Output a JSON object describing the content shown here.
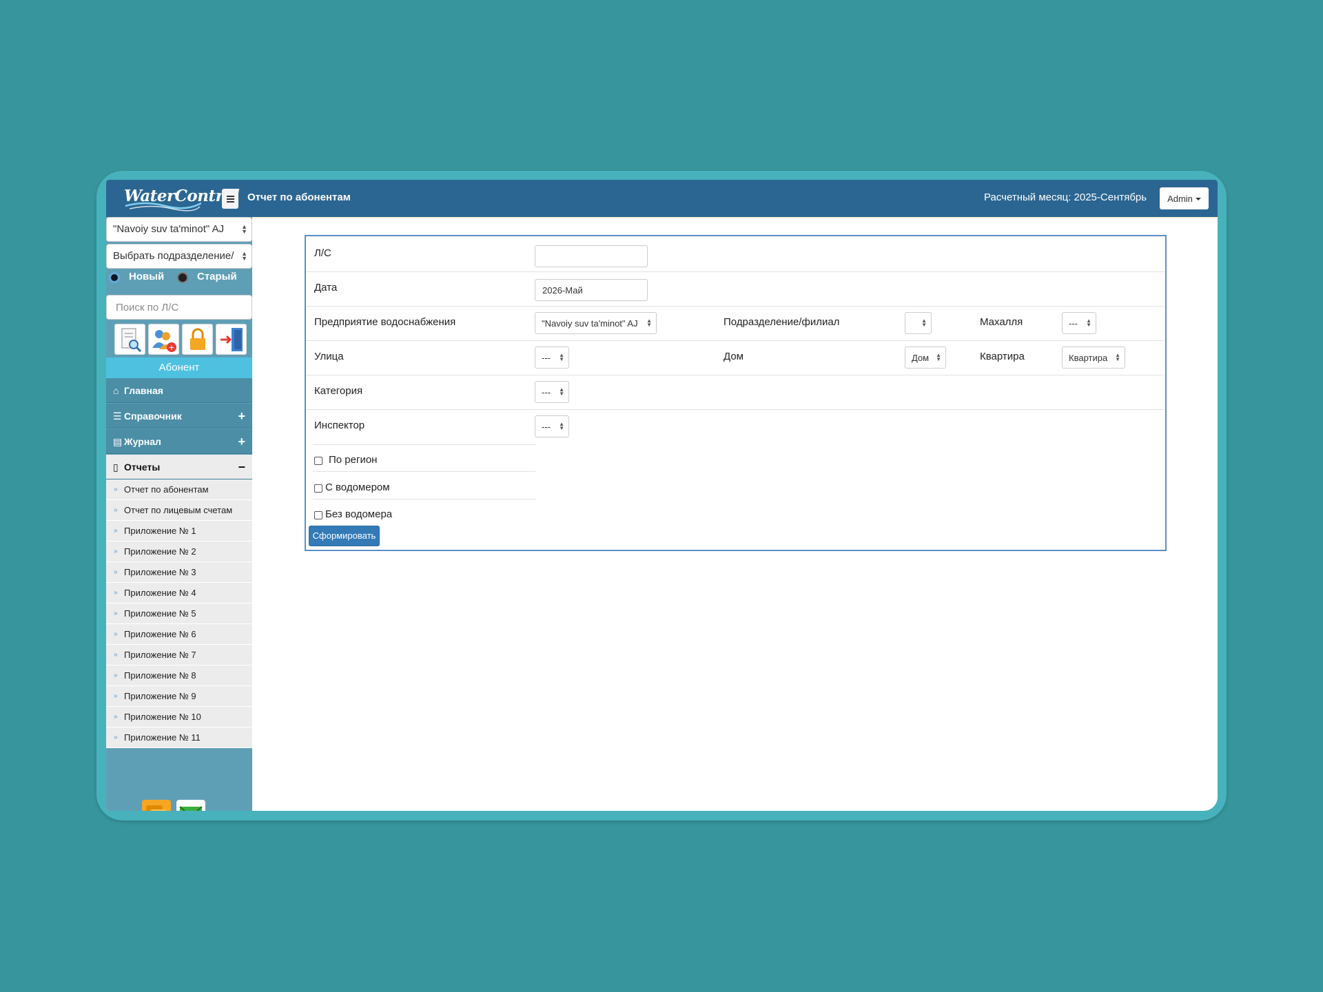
{
  "header": {
    "logo_text": "WaterControl",
    "page_title": "Отчет по абонентам",
    "billing_month": "Расчетный месяц: 2025-Сентябрь",
    "user_button": "Admin"
  },
  "sidebar": {
    "enterprise_select": "\"Navoiy suv ta'minot\" AJ",
    "division_select": "Выбрать подразделение/",
    "radio_new": "Новый",
    "radio_old": "Старый",
    "search_placeholder": "Поиск по Л/С",
    "tool_icons": [
      "search-document-icon",
      "add-user-icon",
      "lock-icon",
      "exit-door-icon"
    ],
    "abonent_label": "Абонент",
    "nav": {
      "home": "Главная",
      "directory": "Справочник",
      "journal": "Журнал",
      "reports": "Отчеты"
    },
    "report_items": [
      "Отчет по абонентам",
      "Отчет по лицевым счетам",
      "Приложение № 1",
      "Приложение № 2",
      "Приложение № 3",
      "Приложение № 4",
      "Приложение № 5",
      "Приложение № 6",
      "Приложение № 7",
      "Приложение № 8",
      "Приложение № 9",
      "Приложение № 10",
      "Приложение № 11"
    ],
    "bottom_icons": [
      "chat-icon",
      "mail-icon"
    ]
  },
  "form": {
    "ls_label": "Л/С",
    "ls_value": "",
    "date_label": "Дата",
    "date_value": "2026-Май",
    "enterprise_label": "Предприятие водоснабжения",
    "enterprise_value": "\"Navoiy suv ta'minot\" AJ",
    "division_label": "Подразделение/филиал",
    "division_value": "",
    "mahalla_label": "Махалля",
    "mahalla_value": "---",
    "street_label": "Улица",
    "street_value": "---",
    "house_label": "Дом",
    "house_value": "Дом",
    "apartment_label": "Квартира",
    "apartment_value": "Квартира",
    "category_label": "Категория",
    "category_value": "---",
    "inspector_label": "Инспектор",
    "inspector_value": "---",
    "by_region_label": "По регион",
    "with_meter_label": "С водомером",
    "without_meter_label": "Без водомера",
    "submit_label": "Сформировать"
  },
  "colors": {
    "background": "#37969d",
    "header": "#2b6692",
    "sidebar": "#5f9fb6",
    "accent": "#4ec0e0",
    "primary_button": "#337ab7"
  }
}
